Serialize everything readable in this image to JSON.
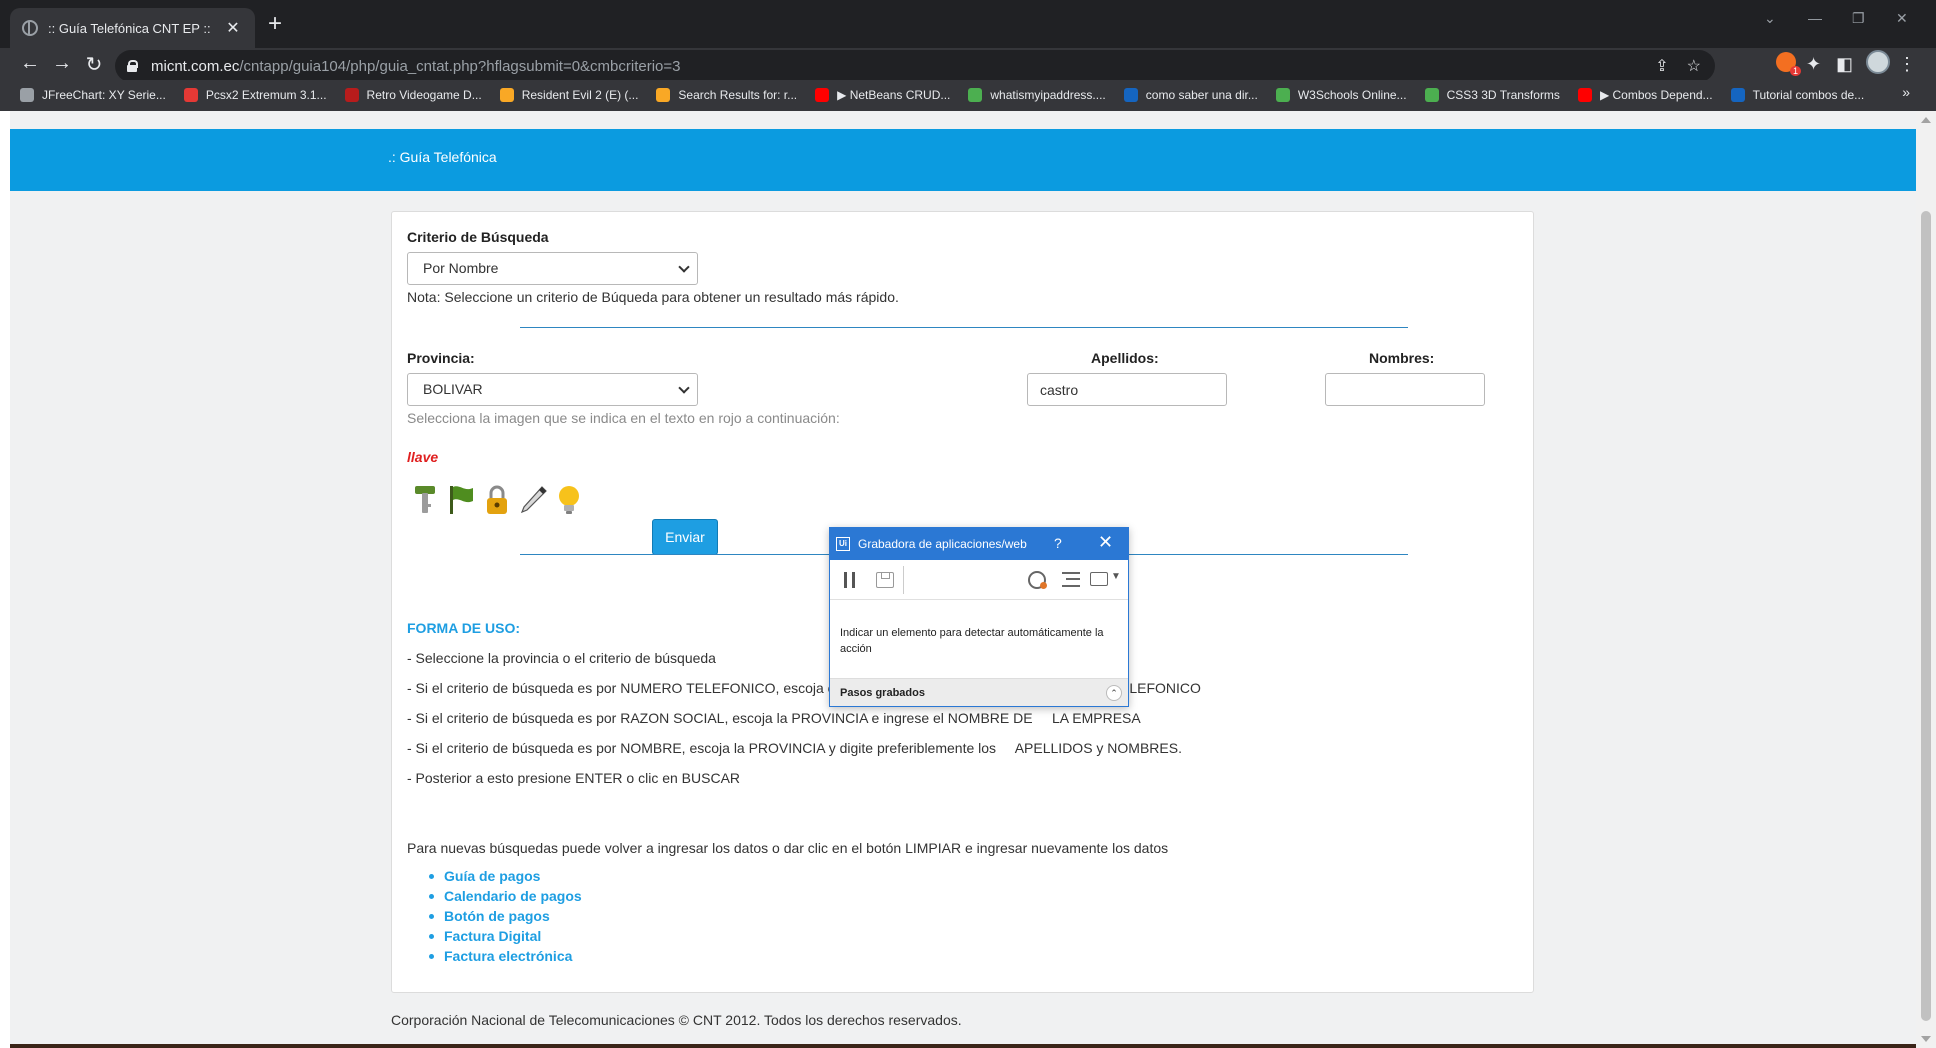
{
  "browser": {
    "tab_title": ":: Guía Telefónica CNT EP ::",
    "url_host": "micnt.com.ec",
    "url_path": "/cntapp/guia104/php/guia_cntat.php?hflagsubmit=0&cmbcriterio=3",
    "bookmarks": [
      {
        "label": "JFreeChart: XY Serie...",
        "color": "#9aa0a6"
      },
      {
        "label": "Pcsx2 Extremum 3.1...",
        "color": "#e53935"
      },
      {
        "label": "Retro Videogame D...",
        "color": "#b71c1c"
      },
      {
        "label": "Resident Evil 2 (E) (...",
        "color": "#f9a825"
      },
      {
        "label": "Search Results for: r...",
        "color": "#f9a825"
      },
      {
        "label": "▶ NetBeans CRUD...",
        "color": "#ff0000"
      },
      {
        "label": "whatismyipaddress....",
        "color": "#4caf50"
      },
      {
        "label": "como saber una dir...",
        "color": "#1565c0"
      },
      {
        "label": "W3Schools Online...",
        "color": "#4caf50"
      },
      {
        "label": "CSS3 3D Transforms",
        "color": "#4caf50"
      },
      {
        "label": "▶ Combos Depend...",
        "color": "#ff0000"
      },
      {
        "label": "Tutorial combos de...",
        "color": "#1565c0"
      }
    ],
    "bookmark_more": "»"
  },
  "page": {
    "header_title": ".: Guía Telefónica",
    "criterio_label": "Criterio de Búsqueda",
    "criterio_value": "Por Nombre",
    "nota": "Nota: Seleccione un criterio de Búqueda para obtener un resultado más rápido.",
    "provincia_label": "Provincia:",
    "provincia_value": "BOLIVAR",
    "apellidos_label": "Apellidos:",
    "apellidos_value": "castro",
    "nombres_label": "Nombres:",
    "nombres_value": "",
    "captcha_hint": "Selecciona la imagen que se indica en el texto en rojo a continuación:",
    "captcha_word": "llave",
    "captcha_icons": [
      "key-icon",
      "flag-icon",
      "padlock-icon",
      "pen-icon",
      "lightbulb-icon"
    ],
    "enviar_label": "Enviar",
    "forma_title": "FORMA DE USO:",
    "instructions": [
      "- Seleccione la provincia o el criterio de búsqueda",
      "- Si el criterio de búsqueda es por NUMERO TELEFONICO, escoja el código de provincia y digite el     NUMERO TELEFONICO",
      "- Si el criterio de búsqueda es por RAZON SOCIAL, escoja la PROVINCIA e ingrese el NOMBRE DE     LA EMPRESA",
      "- Si el criterio de búsqueda es por NOMBRE, escoja la PROVINCIA y digite preferiblemente los     APELLIDOS y NOMBRES.",
      "- Posterior a esto presione ENTER o clic en BUSCAR"
    ],
    "new_search_note": "Para nuevas búsquedas puede volver a ingresar los datos o dar clic en el botón LIMPIAR e ingresar nuevamente los datos",
    "links": [
      "Guía de pagos",
      "Calendario de pagos",
      "Botón de pagos",
      "Factura Digital",
      "Factura electrónica"
    ],
    "footer": "Corporación Nacional de Telecomunicaciones © CNT 2012. Todos los derechos reservados."
  },
  "recorder": {
    "logo": "Ui",
    "title": "Grabadora de aplicaciones/web",
    "help": "?",
    "close": "✕",
    "message": "Indicar un elemento para detectar automáticamente la acción",
    "steps_label": "Pasos grabados",
    "collapse": "⌃"
  },
  "colors": {
    "accent_blue": "#0b9be0",
    "link_blue": "#1e9ee2",
    "captcha_red": "#e02020",
    "recorder_blue": "#2b78d4"
  }
}
